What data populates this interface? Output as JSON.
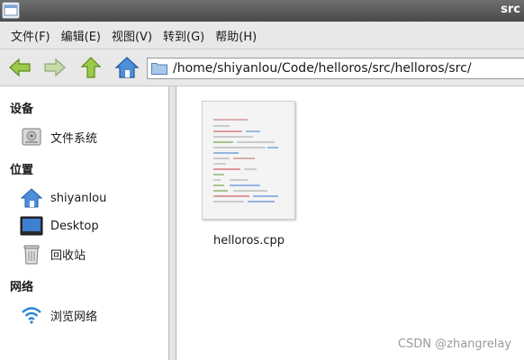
{
  "window": {
    "title": "src"
  },
  "menu": {
    "items": [
      "文件(F)",
      "编辑(E)",
      "视图(V)",
      "转到(G)",
      "帮助(H)"
    ]
  },
  "toolbar": {
    "path": "/home/shiyanlou/Code/helloros/src/helloros/src/"
  },
  "sidebar": {
    "devices_header": "设备",
    "devices": [
      {
        "label": "文件系统",
        "icon": "harddisk-icon"
      }
    ],
    "places_header": "位置",
    "places": [
      {
        "label": "shiyanlou",
        "icon": "home-icon"
      },
      {
        "label": "Desktop",
        "icon": "desktop-icon"
      },
      {
        "label": "回收站",
        "icon": "trash-icon"
      }
    ],
    "network_header": "网络",
    "network": [
      {
        "label": "浏览网络",
        "icon": "wifi-icon"
      }
    ]
  },
  "files": [
    {
      "name": "helloros.cpp",
      "icon": "source-file-icon"
    }
  ],
  "watermark": "CSDN @zhangrelay"
}
